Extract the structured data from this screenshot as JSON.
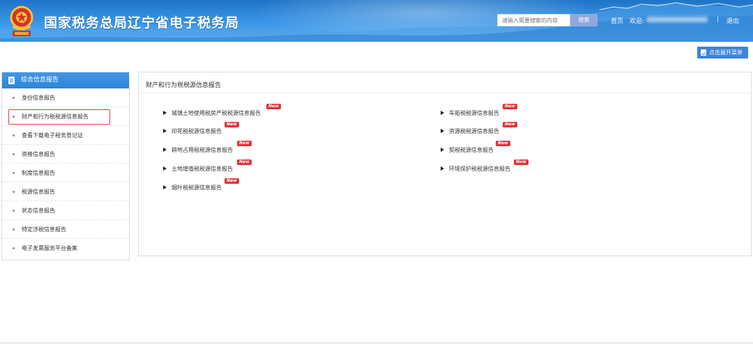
{
  "header": {
    "title": "国家税务总局辽宁省电子税务局",
    "emblem_icon": "tax-emblem-icon",
    "search": {
      "placeholder": "请输入需要搜索的内容",
      "button_label": "搜索"
    },
    "home_link": "首页",
    "welcome": "欢迎:",
    "separator": "|",
    "logout": "退出",
    "colors": {
      "top": "#1e74c8",
      "bottom": "#66b6f2"
    }
  },
  "toolbar": {
    "expand_menu_label": "点击展开菜单",
    "expand_icon": "expand-icon"
  },
  "sidebar": {
    "header_label": "综合信息报告",
    "header_icon": "document-icon",
    "items": [
      {
        "label": "身份信息报告",
        "active": false
      },
      {
        "label": "财产和行为税税源信息报告",
        "active": true
      },
      {
        "label": "查看下载电子税务登记证",
        "active": false
      },
      {
        "label": "资格信息报告",
        "active": false
      },
      {
        "label": "制度信息报告",
        "active": false
      },
      {
        "label": "税源信息报告",
        "active": false
      },
      {
        "label": "状态信息报告",
        "active": false
      },
      {
        "label": "特定涉税信息报告",
        "active": false
      },
      {
        "label": "电子发票服务平台备案",
        "active": false
      }
    ]
  },
  "main": {
    "title": "财产和行为税税源信息报告",
    "new_badge": "New",
    "reports_left": [
      {
        "label": "城镇土地使用税房产税税源信息报告"
      },
      {
        "label": "印花税税源信息报告"
      },
      {
        "label": "耕地占用税税源信息报告"
      },
      {
        "label": "土地增值税税源信息报告"
      },
      {
        "label": "烟叶税税源信息报告"
      }
    ],
    "reports_right": [
      {
        "label": "车船税税源信息报告"
      },
      {
        "label": "资源税税源信息报告"
      },
      {
        "label": "契税税源信息报告"
      },
      {
        "label": "环境保护税税源信息报告"
      }
    ],
    "accent_color": "#e0343b"
  }
}
